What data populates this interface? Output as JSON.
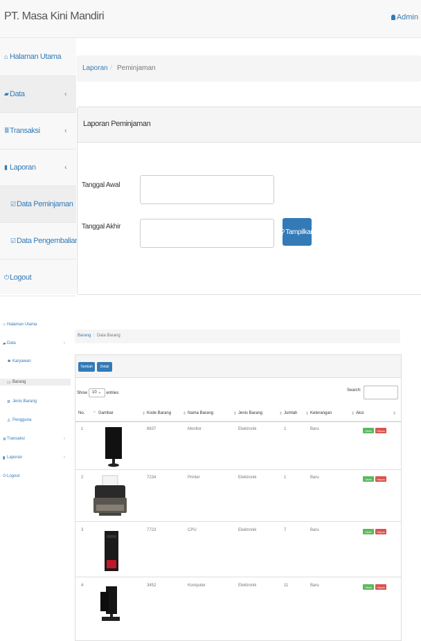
{
  "header": {
    "brand": "PT. Masa Kini Mandiri",
    "user": "Admin"
  },
  "sidebar": {
    "items": [
      {
        "label": "Halaman Utama",
        "icon": "home-icon"
      },
      {
        "label": "Data",
        "icon": "folder-icon"
      },
      {
        "label": "Transaksi",
        "icon": "list-icon"
      },
      {
        "label": "Laporan",
        "icon": "file-icon"
      },
      {
        "label": "Data Peminjaman",
        "icon": "checkbox-icon"
      },
      {
        "label": "Data Pengembalian",
        "icon": "checkbox-icon"
      },
      {
        "label": "Logout",
        "icon": "power-icon"
      }
    ],
    "chevron": "‹"
  },
  "breadcrumb": {
    "parent": "Laporan",
    "separator": "/",
    "current": "Peminjaman"
  },
  "report": {
    "title": "Laporan Peminjaman",
    "start_label": "Tanggal Awal",
    "end_label": "Tanggal Akhir",
    "start_value": "",
    "end_value": "",
    "button": "Tampilkan"
  },
  "inner": {
    "sidebar": [
      {
        "label": "Halaman Utama"
      },
      {
        "label": "Data"
      },
      {
        "label": "Karyawan"
      },
      {
        "label": "Barang"
      },
      {
        "label": "Jenis Barang"
      },
      {
        "label": "Pengguna"
      },
      {
        "label": "Transaksi"
      },
      {
        "label": "Laporan"
      },
      {
        "label": "Logout"
      }
    ],
    "breadcrumb": {
      "parent": "Barang",
      "separator": "/",
      "current": "Data Barang"
    },
    "buttons": {
      "add": "Tambah",
      "detail": "Detail"
    },
    "show": {
      "prefix": "Show",
      "value": "10",
      "suffix": "entries"
    },
    "search_label": "Search:",
    "columns": [
      "No.",
      "Gambar",
      "Kode Barang",
      "Nama Barang",
      "Jenis Barang",
      "Jumlah",
      "Keterangan",
      "Aksi"
    ],
    "rows": [
      {
        "no": "1",
        "kode": "8637",
        "nama": "Monitor",
        "jenis": "Elektronik",
        "jumlah": "1",
        "ket": "Baru"
      },
      {
        "no": "2",
        "kode": "7234",
        "nama": "Printer",
        "jenis": "Elektronik",
        "jumlah": "1",
        "ket": "Baru"
      },
      {
        "no": "3",
        "kode": "7723",
        "nama": "CPU",
        "jenis": "Elektronik",
        "jumlah": "7",
        "ket": "Baru"
      },
      {
        "no": "4",
        "kode": "3452",
        "nama": "Komputer",
        "jenis": "Elektronik",
        "jumlah": "11",
        "ket": "Baru"
      }
    ],
    "actions": {
      "edit": "Ubah",
      "delete": "Hapus"
    }
  },
  "colors": {
    "link": "#337ab7",
    "primary": "#337ab7",
    "success": "#5cb85c",
    "danger": "#d9534f"
  }
}
